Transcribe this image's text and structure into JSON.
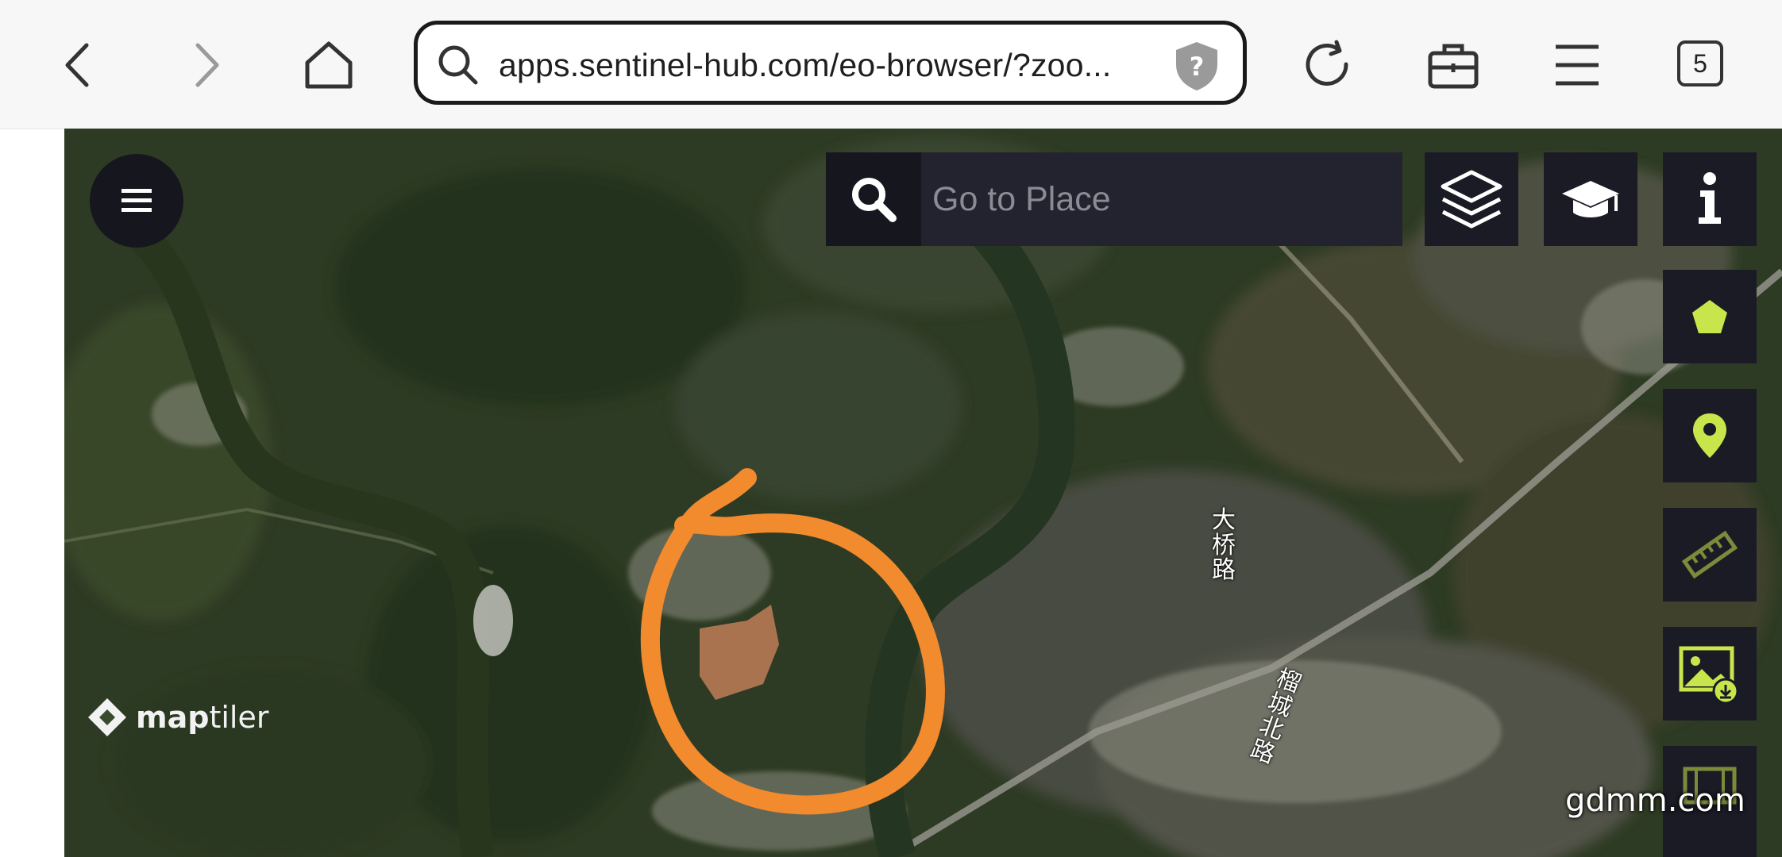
{
  "browser": {
    "url": "apps.sentinel-hub.com/eo-browser/?zoo...",
    "tab_count": "5",
    "icons": {
      "back": "chevron-left-icon",
      "forward": "chevron-right-icon",
      "home": "home-icon",
      "search": "search-icon",
      "security": "shield-question-icon",
      "reload": "reload-icon",
      "toolbox": "briefcase-icon",
      "menu": "hamburger-menu-icon"
    }
  },
  "map": {
    "search_placeholder": "Go to Place",
    "attribution": {
      "part1": "map",
      "part2": "tiler"
    },
    "watermark": "gdmm.com",
    "road_labels": [
      {
        "text": "大桥路"
      },
      {
        "text": "榴城北路"
      }
    ],
    "colors": {
      "accent": "#c8e64b",
      "panel": "#1b1b26",
      "annotation": "#f28a2e"
    },
    "toolbar": [
      {
        "name": "info-button",
        "icon": "info-icon"
      },
      {
        "name": "draw-polygon-button",
        "icon": "pentagon-icon"
      },
      {
        "name": "place-marker-button",
        "icon": "map-pin-icon"
      },
      {
        "name": "measure-button",
        "icon": "ruler-icon"
      },
      {
        "name": "download-image-button",
        "icon": "image-download-icon"
      },
      {
        "name": "timelapse-button",
        "icon": "film-icon"
      }
    ]
  }
}
